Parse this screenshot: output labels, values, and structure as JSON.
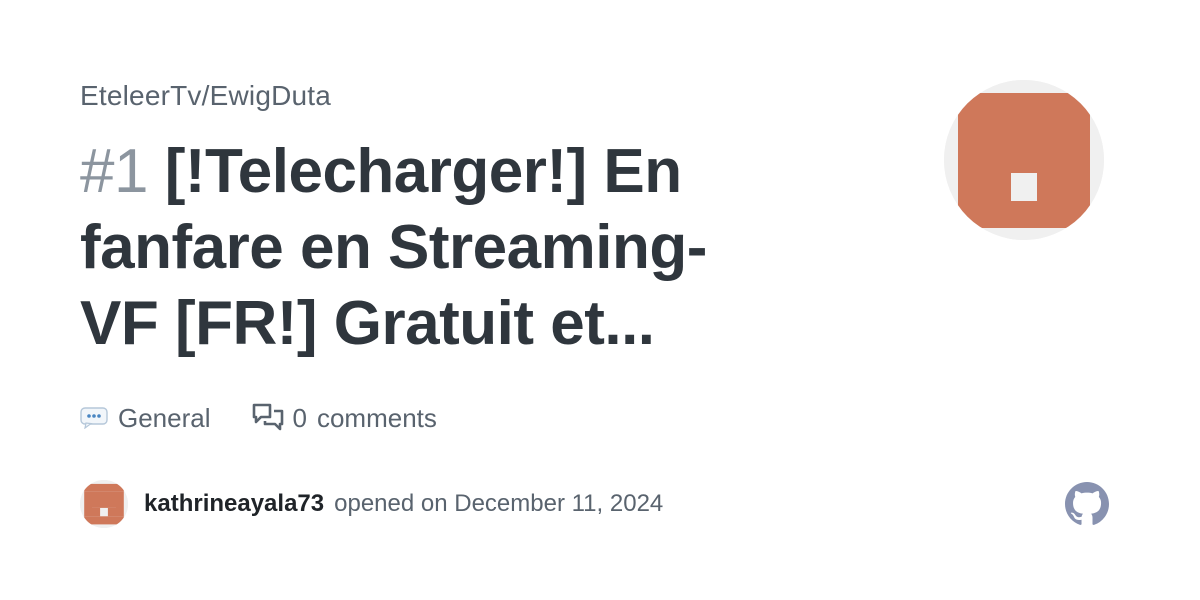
{
  "repo": {
    "name": "EteleerTv/EwigDuta"
  },
  "issue": {
    "number": "#1",
    "title": "[!Telecharger!] En fanfare en Streaming-VF [FR!] Gratuit et..."
  },
  "meta": {
    "category_icon": "speech-balloon-icon",
    "category": "General",
    "comments_icon": "comment-discussion-icon",
    "comment_count": "0",
    "comments_label": "comments"
  },
  "author": {
    "username": "kathrineayala73",
    "opened_text": "opened on December 11, 2024"
  },
  "colors": {
    "avatar_fill": "#cf785a",
    "avatar_background": "#f0f0f0",
    "github_logo": "#8892b0"
  }
}
